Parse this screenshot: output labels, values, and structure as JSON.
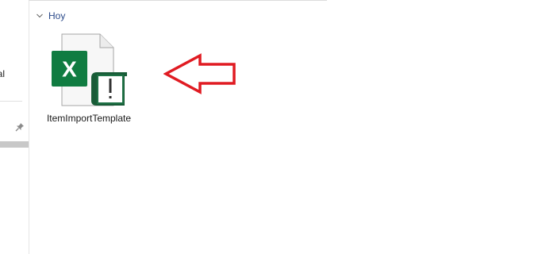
{
  "nav": {
    "item_label": "nal",
    "icons": {
      "pin": "pin-icon"
    }
  },
  "group": {
    "label": "Hoy",
    "icon": "chevron-down-icon"
  },
  "file": {
    "name": "ItemImportTemplate",
    "icon": "excel-file-warning-icon",
    "excel_letter": "X"
  },
  "annotation": {
    "icon": "arrow-left-icon",
    "color": "#e01b22"
  },
  "colors": {
    "excel_green": "#107c41",
    "excel_dark": "#185c37",
    "group_text": "#2b4a8a"
  }
}
